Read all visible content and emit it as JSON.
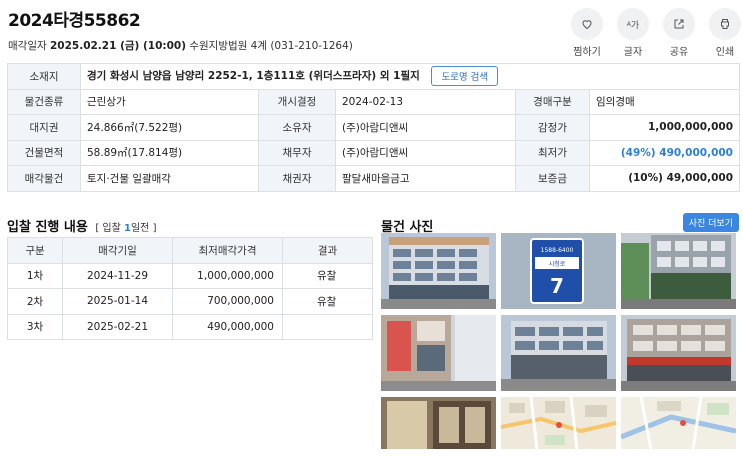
{
  "header": {
    "case_no": "2024타경55862",
    "sale_date_label": "매각일자",
    "sale_date": "2025.02.21 (금) (10:00)",
    "court": "수원지방법원 4계 (031-210-1264)"
  },
  "actions": [
    {
      "label": "찜하기",
      "icon": "heart-icon"
    },
    {
      "label": "글자",
      "icon": "font-size-icon"
    },
    {
      "label": "공유",
      "icon": "share-icon"
    },
    {
      "label": "인쇄",
      "icon": "print-icon"
    }
  ],
  "actions_font_glyph": "가",
  "info": {
    "address_label": "소재지",
    "address": "경기 화성시 남양읍 남양리 2252-1, 1층111호 (위더스프라자) 외 1필지",
    "road_btn": "도로명 검색",
    "rows": [
      [
        {
          "k": "물건종류",
          "v": "근린상가"
        },
        {
          "k": "개시결정",
          "v": "2024-02-13"
        },
        {
          "k": "경매구분",
          "v": "임의경매"
        }
      ],
      [
        {
          "k": "대지권",
          "v": "24.866㎡(7.522평)"
        },
        {
          "k": "소유자",
          "v": "(주)아람디앤씨"
        },
        {
          "k": "감정가",
          "v": "1,000,000,000"
        }
      ],
      [
        {
          "k": "건물면적",
          "v": "58.89㎡(17.814평)"
        },
        {
          "k": "채무자",
          "v": "(주)아람디앤씨"
        },
        {
          "k": "최저가",
          "v": "(49%) 490,000,000"
        }
      ],
      [
        {
          "k": "매각물건",
          "v": "토지·건물 일괄매각"
        },
        {
          "k": "채권자",
          "v": "팔달새마을금고"
        },
        {
          "k": "보증금",
          "v": "(10%) 49,000,000"
        }
      ]
    ]
  },
  "bid": {
    "title": "입찰 진행 내용",
    "sub_pre": "[ 입찰",
    "sub_num": "1",
    "sub_post": "일전 ]",
    "headers": [
      "구분",
      "매각기일",
      "최저매각가격",
      "결과"
    ],
    "rows": [
      [
        "1차",
        "2024-11-29",
        "1,000,000,000",
        "유찰"
      ],
      [
        "2차",
        "2025-01-14",
        "700,000,000",
        "유찰"
      ],
      [
        "3차",
        "2025-02-21",
        "490,000,000",
        ""
      ]
    ]
  },
  "photos": {
    "title": "물건 사진",
    "more_btn": "사진 더보기",
    "sign_top": "1588-6400",
    "sign_mid": "시청로",
    "sign_num": "7"
  },
  "colors": {
    "accent": "#2b7fd9",
    "header_bg": "#f1f4f8",
    "border": "#dcdfe4"
  }
}
